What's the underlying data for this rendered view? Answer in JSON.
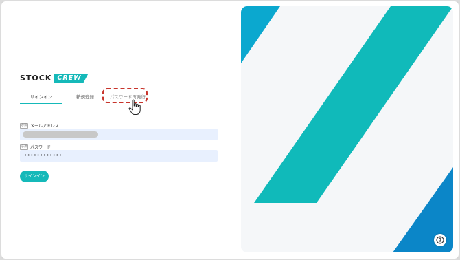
{
  "brand": {
    "word1": "STOCK",
    "word2": "CREW",
    "accent": "#15b9b9"
  },
  "tabs": [
    {
      "label": "サインイン",
      "active": true
    },
    {
      "label": "新規登録",
      "active": false
    },
    {
      "label": "パスワード再発行",
      "active": false
    }
  ],
  "form": {
    "email": {
      "label": "メールアドレス",
      "required_badge": "必須"
    },
    "password": {
      "label": "パスワード",
      "required_badge": "必須",
      "value": "••••••••••••"
    },
    "submit_label": "サインイン"
  },
  "hero": {
    "colors": {
      "background": "#f5f7f9",
      "teal": "#10baba",
      "blue_top": "#0ba8cf",
      "blue_bottom": "#0b86c8"
    }
  },
  "help": {
    "icon": "question-icon"
  },
  "annotation": {
    "color": "#c8342b",
    "cursor_icon": "hand-pointer-icon"
  }
}
